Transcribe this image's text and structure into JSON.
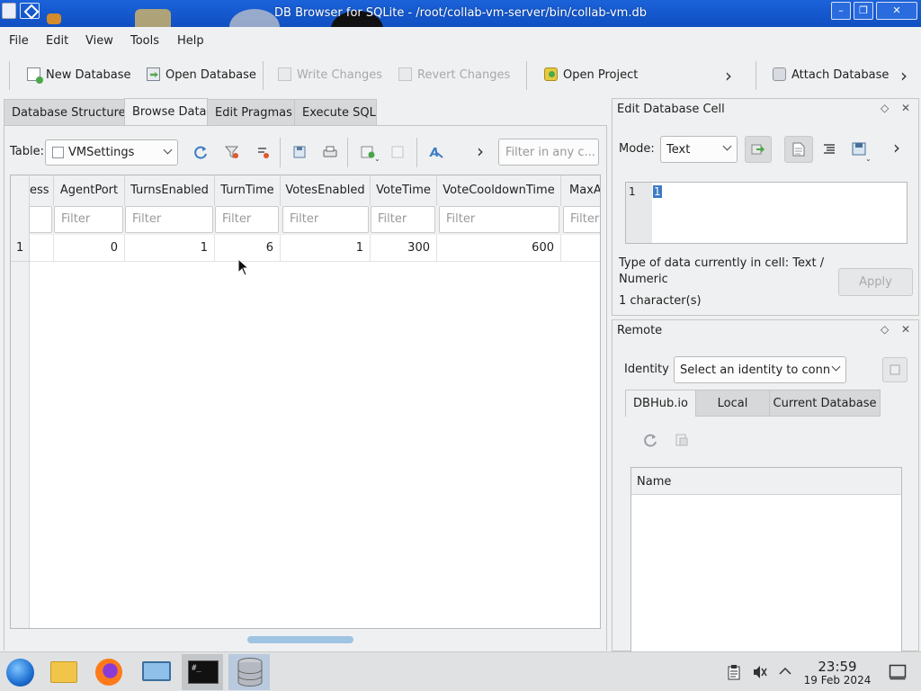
{
  "window": {
    "title": "DB Browser for SQLite - /root/collab-vm-server/bin/collab-vm.db",
    "controls": [
      "minimize",
      "maximize",
      "close"
    ]
  },
  "menu": [
    "File",
    "Edit",
    "View",
    "Tools",
    "Help"
  ],
  "toolbar": {
    "new_database": "New Database",
    "open_database": "Open Database",
    "write_changes": "Write Changes",
    "revert_changes": "Revert Changes",
    "open_project": "Open Project",
    "attach_database": "Attach Database"
  },
  "tabs": [
    "Database Structure",
    "Browse Data",
    "Edit Pragmas",
    "Execute SQL"
  ],
  "browse": {
    "table_label": "Table:",
    "table_value": "VMSettings",
    "filter_any_placeholder": "Filter in any c..."
  },
  "grid": {
    "columns": [
      "ess",
      "AgentPort",
      "TurnsEnabled",
      "TurnTime",
      "VotesEnabled",
      "VoteTime",
      "VoteCooldownTime",
      "MaxA"
    ],
    "filter_placeholder": "Filter",
    "rows": [
      {
        "row": "1",
        "cells": [
          "",
          "0",
          "1",
          "6",
          "1",
          "300",
          "600",
          ""
        ]
      }
    ]
  },
  "edit_cell": {
    "title": "Edit Database Cell",
    "mode_label": "Mode:",
    "mode_value": "Text",
    "line_no": "1",
    "value": "1",
    "type_info": "Type of data currently in cell: Text / Numeric",
    "char_count": "1 character(s)",
    "apply": "Apply"
  },
  "remote": {
    "title": "Remote",
    "identity_label": "Identity",
    "identity_value": "Select an identity to connec",
    "tabs": [
      "DBHub.io",
      "Local",
      "Current Database"
    ],
    "name_header": "Name"
  },
  "taskbar": {
    "time": "23:59",
    "date": "19 Feb 2024"
  }
}
